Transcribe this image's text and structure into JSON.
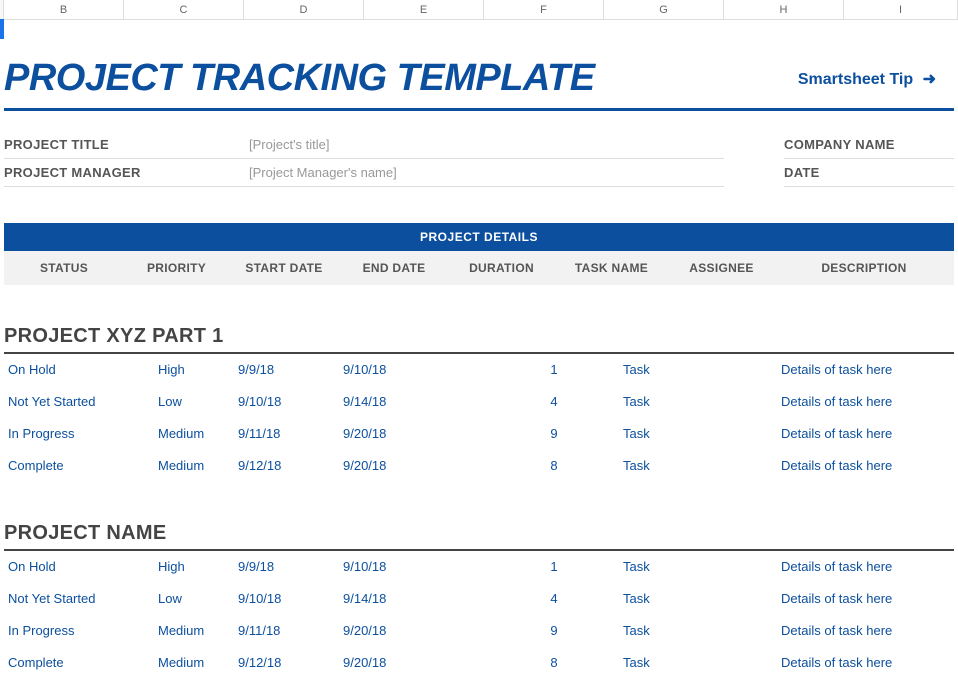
{
  "columns": [
    "B",
    "C",
    "D",
    "E",
    "F",
    "G",
    "H",
    "I"
  ],
  "title": "PROJECT TRACKING TEMPLATE",
  "tip_link": "Smartsheet Tip",
  "tip_arrow": "➜",
  "meta": {
    "left": [
      {
        "label": "PROJECT TITLE",
        "value": "[Project's title]"
      },
      {
        "label": "PROJECT MANAGER",
        "value": "[Project Manager's name]"
      }
    ],
    "right": [
      {
        "label": "COMPANY NAME"
      },
      {
        "label": "DATE"
      }
    ]
  },
  "details_banner": "PROJECT DETAILS",
  "column_headers": [
    "STATUS",
    "PRIORITY",
    "START DATE",
    "END DATE",
    "DURATION",
    "TASK NAME",
    "ASSIGNEE",
    "DESCRIPTION"
  ],
  "sections": [
    {
      "title": "PROJECT XYZ PART 1",
      "rows": [
        {
          "status": "On Hold",
          "priority": "High",
          "start": "9/9/18",
          "end": "9/10/18",
          "duration": "1",
          "task": "Task",
          "assignee": "",
          "desc": "Details of task here"
        },
        {
          "status": "Not Yet Started",
          "priority": "Low",
          "start": "9/10/18",
          "end": "9/14/18",
          "duration": "4",
          "task": "Task",
          "assignee": "",
          "desc": "Details of task here"
        },
        {
          "status": "In Progress",
          "priority": "Medium",
          "start": "9/11/18",
          "end": "9/20/18",
          "duration": "9",
          "task": "Task",
          "assignee": "",
          "desc": "Details of task here"
        },
        {
          "status": "Complete",
          "priority": "Medium",
          "start": "9/12/18",
          "end": "9/20/18",
          "duration": "8",
          "task": "Task",
          "assignee": "",
          "desc": "Details of task here"
        }
      ]
    },
    {
      "title": "PROJECT NAME",
      "rows": [
        {
          "status": "On Hold",
          "priority": "High",
          "start": "9/9/18",
          "end": "9/10/18",
          "duration": "1",
          "task": "Task",
          "assignee": "",
          "desc": "Details of task here"
        },
        {
          "status": "Not Yet Started",
          "priority": "Low",
          "start": "9/10/18",
          "end": "9/14/18",
          "duration": "4",
          "task": "Task",
          "assignee": "",
          "desc": "Details of task here"
        },
        {
          "status": "In Progress",
          "priority": "Medium",
          "start": "9/11/18",
          "end": "9/20/18",
          "duration": "9",
          "task": "Task",
          "assignee": "",
          "desc": "Details of task here"
        },
        {
          "status": "Complete",
          "priority": "Medium",
          "start": "9/12/18",
          "end": "9/20/18",
          "duration": "8",
          "task": "Task",
          "assignee": "",
          "desc": "Details of task here"
        }
      ]
    }
  ]
}
